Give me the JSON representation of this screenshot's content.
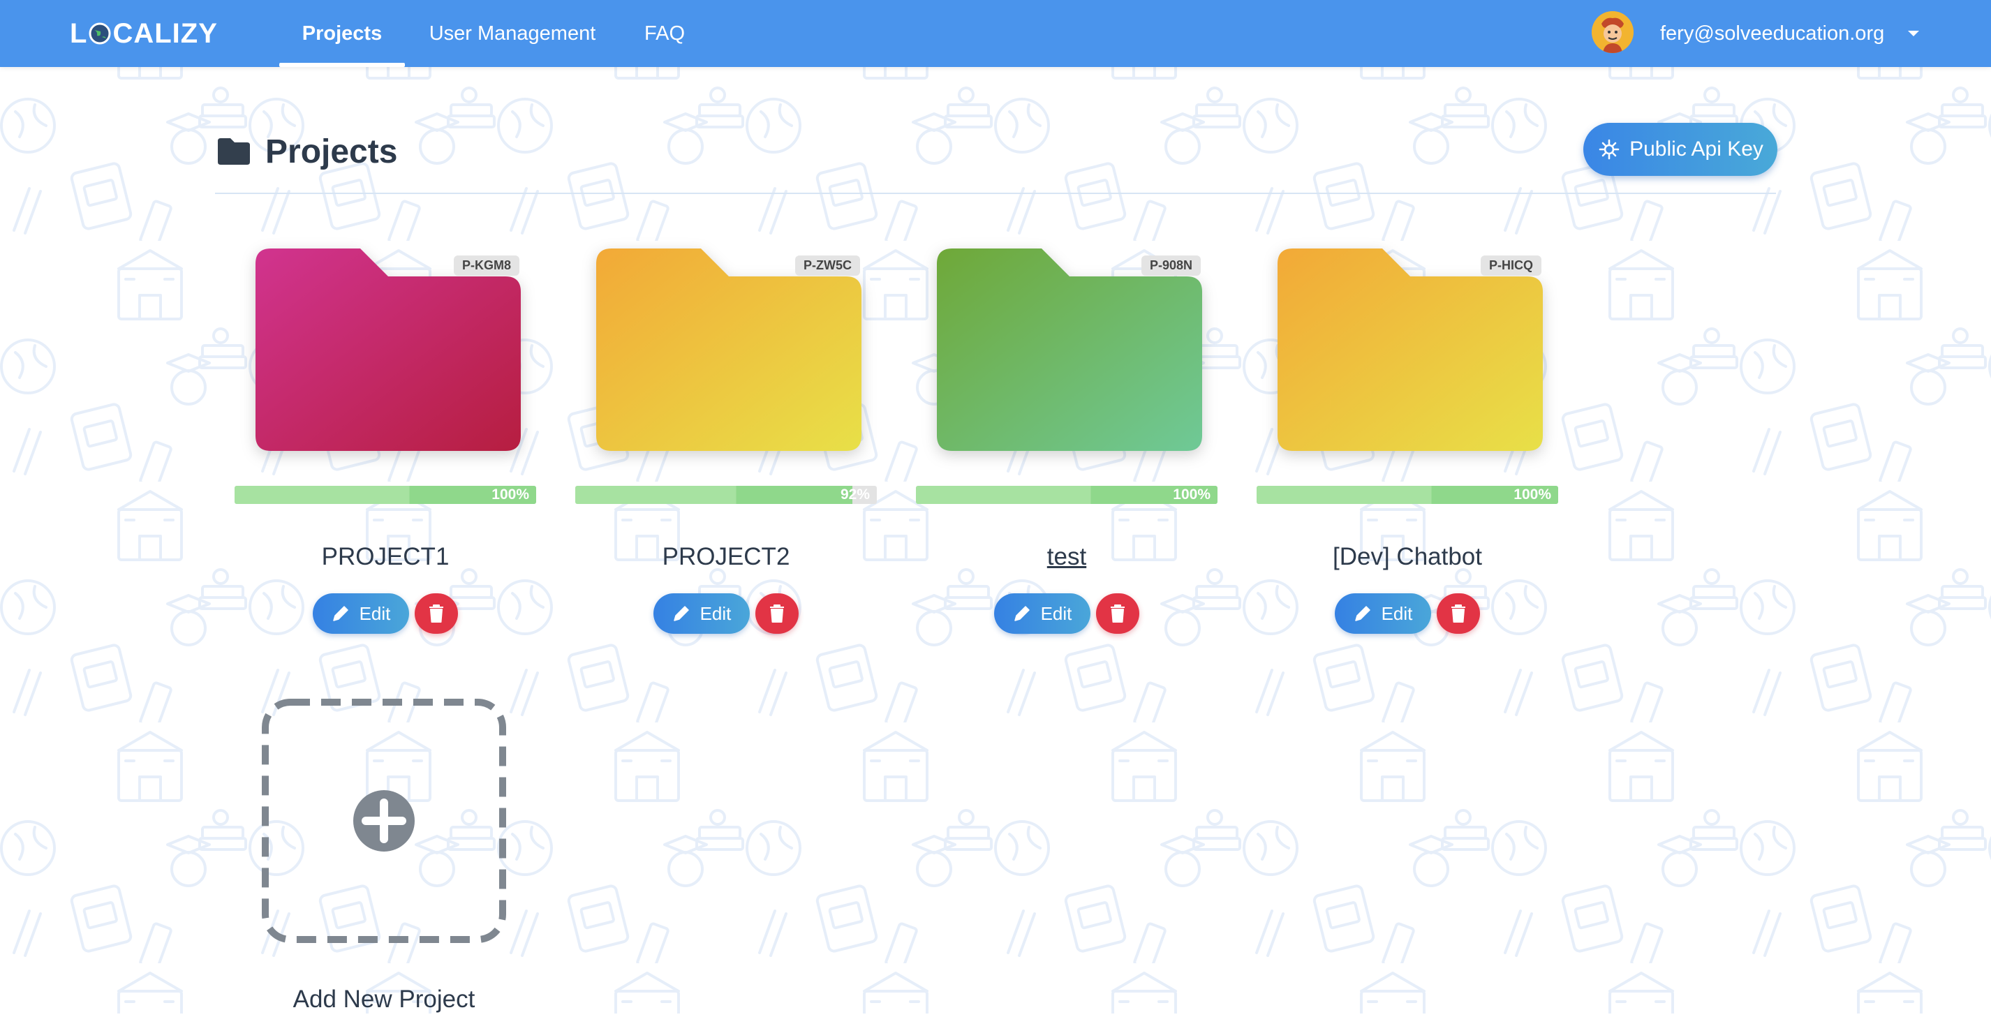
{
  "navbar": {
    "logo_text": {
      "l": "L",
      "rest": "CALIZY"
    },
    "tabs": [
      {
        "label": "Projects",
        "active": true
      },
      {
        "label": "User Management",
        "active": false
      },
      {
        "label": "FAQ",
        "active": false
      }
    ],
    "user_email": "fery@solveeducation.org",
    "background_color": "#4a94ec"
  },
  "page": {
    "title": "Projects",
    "api_button_label": "Public Api Key"
  },
  "projects": [
    {
      "code": "P-KGM8",
      "name": "PROJECT1",
      "progress": 100,
      "progress_label": "100%",
      "edit_label": "Edit",
      "color_start": "#d1348f",
      "color_end": "#b61e40"
    },
    {
      "code": "P-ZW5C",
      "name": "PROJECT2",
      "progress": 92,
      "progress_label": "92%",
      "edit_label": "Edit",
      "color_start": "#f2a937",
      "color_end": "#e8e048"
    },
    {
      "code": "P-908N",
      "name": "test",
      "progress": 100,
      "progress_label": "100%",
      "edit_label": "Edit",
      "color_start": "#6fa838",
      "color_end": "#6fc997"
    },
    {
      "code": "P-HICQ",
      "name": "[Dev] Chatbot",
      "progress": 100,
      "progress_label": "100%",
      "edit_label": "Edit",
      "color_start": "#f2a937",
      "color_end": "#e8e048"
    }
  ],
  "add_project": {
    "label": "Add New Project"
  }
}
